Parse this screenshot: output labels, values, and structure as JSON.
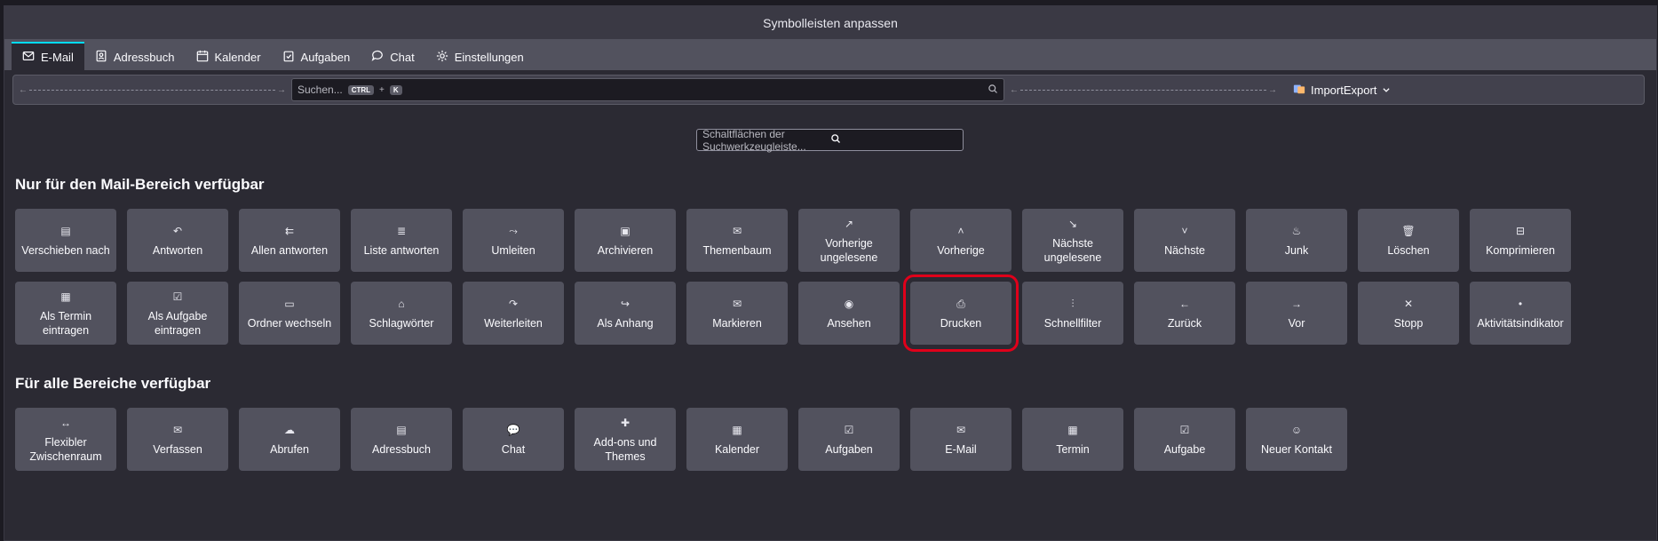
{
  "window": {
    "title": "Symbolleisten anpassen"
  },
  "tabs": [
    {
      "label": "E-Mail",
      "icon": "mail-icon"
    },
    {
      "label": "Adressbuch",
      "icon": "addressbook-icon"
    },
    {
      "label": "Kalender",
      "icon": "calendar-icon"
    },
    {
      "label": "Aufgaben",
      "icon": "tasks-icon"
    },
    {
      "label": "Chat",
      "icon": "chat-icon"
    },
    {
      "label": "Einstellungen",
      "icon": "gear-icon"
    }
  ],
  "toolbar_preview": {
    "search_placeholder": "Suchen...",
    "kbd_ctrl": "CTRL",
    "kbd_plus": "+",
    "kbd_k": "K",
    "import_label": "ImportExport"
  },
  "find": {
    "placeholder": "Schaltflächen der Suchwerkzeugleiste..."
  },
  "sections": {
    "mail_only": "Nur für den Mail-Bereich verfügbar",
    "all_spaces": "Für alle Bereiche verfügbar"
  },
  "mail_buttons_row1": [
    {
      "label": "Verschieben nach",
      "icon": "move-icon"
    },
    {
      "label": "Antworten",
      "icon": "reply-icon"
    },
    {
      "label": "Allen antworten",
      "icon": "reply-all-icon"
    },
    {
      "label": "Liste antworten",
      "icon": "reply-list-icon"
    },
    {
      "label": "Umleiten",
      "icon": "redirect-icon"
    },
    {
      "label": "Archivieren",
      "icon": "archive-icon"
    },
    {
      "label": "Themenbaum",
      "icon": "thread-icon"
    },
    {
      "label": "Vorherige ungelesene",
      "icon": "previous-unread-icon"
    },
    {
      "label": "Vorherige",
      "icon": "chevron-up-icon"
    },
    {
      "label": "Nächste ungelesene",
      "icon": "next-unread-icon"
    },
    {
      "label": "Nächste",
      "icon": "chevron-down-icon"
    },
    {
      "label": "Junk",
      "icon": "junk-icon"
    },
    {
      "label": "Löschen",
      "icon": "trash-icon"
    },
    {
      "label": "Komprimieren",
      "icon": "compact-icon"
    }
  ],
  "mail_buttons_row2": [
    {
      "label": "Als Termin eintragen",
      "icon": "event-icon"
    },
    {
      "label": "Als Aufgabe eintragen",
      "icon": "task-icon"
    },
    {
      "label": "Ordner wechseln",
      "icon": "folder-icon"
    },
    {
      "label": "Schlagwörter",
      "icon": "tag-icon"
    },
    {
      "label": "Weiterleiten",
      "icon": "forward-icon"
    },
    {
      "label": "Als Anhang",
      "icon": "forward-attachment-icon"
    },
    {
      "label": "Markieren",
      "icon": "mark-icon"
    },
    {
      "label": "Ansehen",
      "icon": "eye-icon"
    },
    {
      "label": "Drucken",
      "icon": "printer-icon"
    },
    {
      "label": "Schnellfilter",
      "icon": "filter-icon"
    },
    {
      "label": "Zurück",
      "icon": "arrow-left-icon"
    },
    {
      "label": "Vor",
      "icon": "arrow-right-icon"
    },
    {
      "label": "Stopp",
      "icon": "close-icon"
    },
    {
      "label": "Aktivitätsindikator",
      "icon": "dot-icon"
    }
  ],
  "all_buttons": [
    {
      "label": "Flexibler Zwischenraum",
      "icon": "spacer-icon"
    },
    {
      "label": "Verfassen",
      "icon": "compose-icon"
    },
    {
      "label": "Abrufen",
      "icon": "get-messages-icon"
    },
    {
      "label": "Adressbuch",
      "icon": "addressbook-icon"
    },
    {
      "label": "Chat",
      "icon": "chat-icon"
    },
    {
      "label": "Add-ons und Themes",
      "icon": "addons-icon"
    },
    {
      "label": "Kalender",
      "icon": "calendar-icon"
    },
    {
      "label": "Aufgaben",
      "icon": "tasks-icon"
    },
    {
      "label": "E-Mail",
      "icon": "mail-icon"
    },
    {
      "label": "Termin",
      "icon": "event-icon"
    },
    {
      "label": "Aufgabe",
      "icon": "task-icon"
    },
    {
      "label": "Neuer Kontakt",
      "icon": "new-contact-icon"
    }
  ],
  "colors": {
    "highlight": "#e0001a",
    "accent": "#00ddff"
  }
}
